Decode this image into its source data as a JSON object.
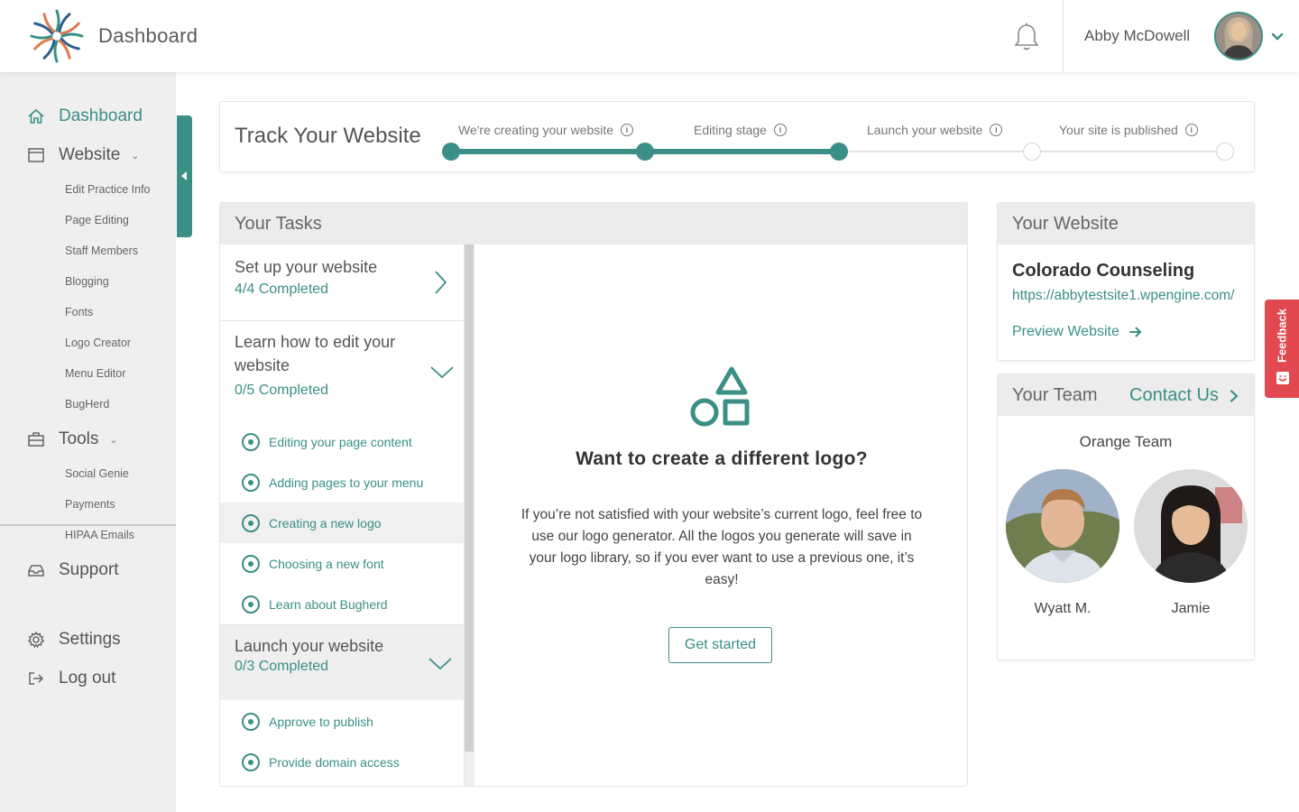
{
  "app": {
    "title": "Dashboard",
    "user_name": "Abby McDowell"
  },
  "colors": {
    "accent": "#3b8f86",
    "sidebar_bg": "#efefef",
    "panel_head_bg": "#ececec",
    "feedback": "#e2484f"
  },
  "sidebar": {
    "main": [
      {
        "label": "Dashboard",
        "icon": "home-icon",
        "active": true
      },
      {
        "label": "Website",
        "icon": "browser-window-icon",
        "expanded": true
      },
      {
        "label": "Tools",
        "icon": "toolbox-icon",
        "expanded": true
      },
      {
        "label": "Support",
        "icon": "inbox-icon"
      },
      {
        "label": "Settings",
        "icon": "gear-icon"
      },
      {
        "label": "Log out",
        "icon": "logout-icon"
      }
    ],
    "website_items": [
      "Edit Practice Info",
      "Page Editing",
      "Staff Members",
      "Blogging",
      "Fonts",
      "Logo Creator",
      "Menu Editor",
      "BugHerd"
    ],
    "tools_items": [
      "Social Genie",
      "Payments",
      "HIPAA Emails"
    ]
  },
  "track": {
    "title": "Track Your Website",
    "steps": [
      {
        "label": "We're creating your website",
        "done": true
      },
      {
        "label": "Editing stage",
        "done": true
      },
      {
        "label": "Launch your website",
        "done": false
      },
      {
        "label": "Your site is published",
        "done": false
      }
    ]
  },
  "tasks": {
    "title": "Your Tasks",
    "groups": [
      {
        "title": "Set up your website",
        "count": "4/4 Completed"
      },
      {
        "title": "Learn how to edit your website",
        "count": "0/5 Completed",
        "items": [
          "Editing your page content",
          "Adding pages to your menu",
          "Creating a new logo",
          "Choosing a new font",
          "Learn about Bugherd"
        ]
      },
      {
        "title": "Launch your website",
        "count": "0/3 Completed",
        "items": [
          "Approve to publish",
          "Provide domain access"
        ]
      }
    ],
    "detail": {
      "icon": "shapes-icon",
      "title": "Want to create a different logo?",
      "body": "If you’re not satisfied with your website’s current logo, feel free to use our logo generator. All the logos you generate will save in your logo library, so if you ever want to use a previous one, it’s easy!",
      "button": "Get started"
    }
  },
  "website_card": {
    "title": "Your Website",
    "site_name": "Colorado Counseling",
    "url": "https://abbytestsite1.wpengine.com/",
    "preview": "Preview Website"
  },
  "team_card": {
    "title": "Your Team",
    "contact": "Contact Us",
    "team_name": "Orange Team",
    "members": [
      {
        "name": "Wyatt M."
      },
      {
        "name": "Jamie"
      }
    ]
  },
  "feedback": {
    "label": "Feedback"
  }
}
